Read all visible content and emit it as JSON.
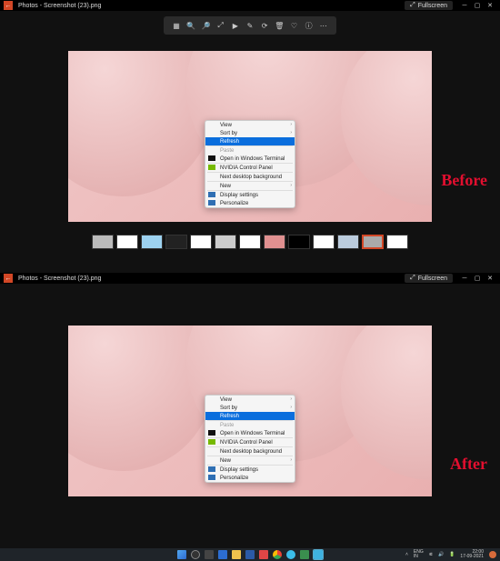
{
  "titlebar": {
    "app": "Photos",
    "file": "Screenshot (23).png",
    "title": "Photos - Screenshot (23).png",
    "fullscreen": "Fullscreen"
  },
  "toolbar_icons": [
    "compare",
    "zoom-in",
    "zoom-out",
    "zoom-fit",
    "slideshow",
    "edit",
    "rotate",
    "delete",
    "favorite",
    "info",
    "more"
  ],
  "context_menu": {
    "view": "View",
    "sortby": "Sort by",
    "refresh": "Refresh",
    "paste": "Paste",
    "open_terminal": "Open in Windows Terminal",
    "nvidia": "NVIDIA Control Panel",
    "next_bg": "Next desktop background",
    "new": "New",
    "display_settings": "Display settings",
    "personalize": "Personalize"
  },
  "labels": {
    "before": "Before",
    "after": "After"
  },
  "thumbs": {
    "count": 13,
    "selected_index": 11
  },
  "taskbar": {
    "lang": "ENG\nIN",
    "time": "22:00",
    "date": "17-09-2021"
  }
}
